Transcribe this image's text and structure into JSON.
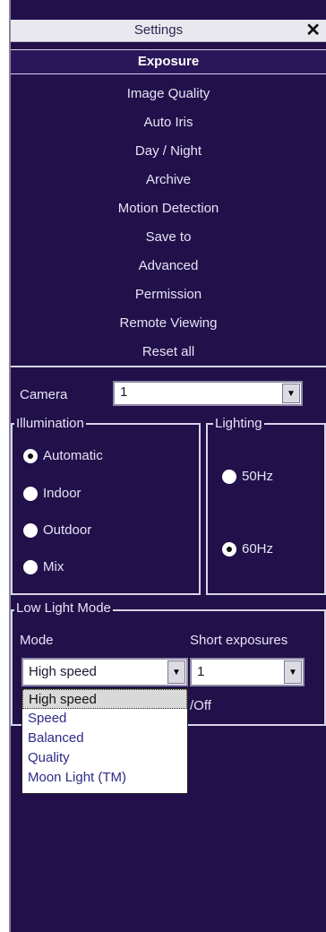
{
  "window": {
    "title": "Settings",
    "close_glyph": "✕"
  },
  "menu": {
    "items": [
      {
        "label": "Exposure",
        "active": true
      },
      {
        "label": "Image Quality"
      },
      {
        "label": "Auto Iris"
      },
      {
        "label": "Day / Night"
      },
      {
        "label": "Archive"
      },
      {
        "label": "Motion Detection"
      },
      {
        "label": "Save to"
      },
      {
        "label": "Advanced"
      },
      {
        "label": "Permission"
      },
      {
        "label": "Remote Viewing"
      },
      {
        "label": "Reset all"
      }
    ]
  },
  "camera": {
    "label": "Camera",
    "value": "1"
  },
  "illumination": {
    "legend": "Illumination",
    "options": [
      {
        "label": "Automatic",
        "checked": true
      },
      {
        "label": "Indoor",
        "checked": false
      },
      {
        "label": "Outdoor",
        "checked": false
      },
      {
        "label": "Mix",
        "checked": false
      }
    ]
  },
  "lighting": {
    "legend": "Lighting",
    "options": [
      {
        "label": "50Hz",
        "checked": false
      },
      {
        "label": "60Hz",
        "checked": true
      }
    ]
  },
  "low_light": {
    "legend": "Low Light Mode",
    "mode_label": "Mode",
    "short_exposures_label": "Short exposures",
    "mode_value": "High speed",
    "short_exposures_value": "1",
    "partial_text": "/Off",
    "dropdown_options": [
      "High speed",
      "Speed",
      "Balanced",
      "Quality",
      "Moon Light (TM)"
    ]
  },
  "colors": {
    "background": "#21104a",
    "text": "#e6e3f5",
    "border": "#d8d5e8"
  }
}
